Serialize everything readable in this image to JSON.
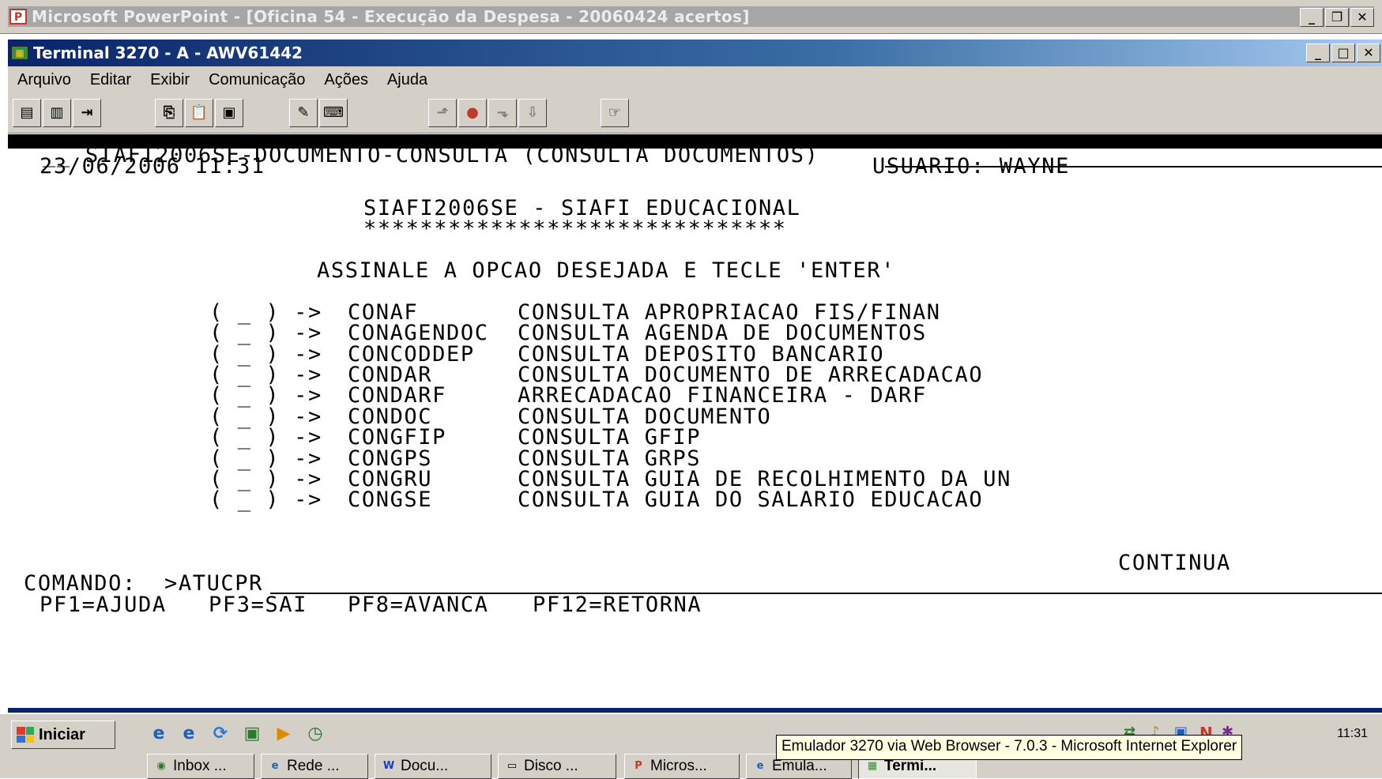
{
  "powerpoint": {
    "title": "Microsoft PowerPoint - [Oficina 54 - Execução da Despesa - 20060424 acertos]"
  },
  "terminal_window": {
    "title": "Terminal 3270 - A - AWV61442"
  },
  "menu": [
    "Arquivo",
    "Editar",
    "Exibir",
    "Comunicação",
    "Ações",
    "Ajuda"
  ],
  "screen": {
    "header_line": "SIAFI2006SE-DOCUMENTO-CONSULTA (CONSULTA DOCUMENTOS)",
    "header_prefix": "__",
    "datetime": "23/06/2006 11:31",
    "user": "USUARIO: WAYNE",
    "system_title": "SIAFI2006SE - SIAFI EDUCACIONAL",
    "stars": "******************************",
    "instruction": "ASSINALE A OPCAO DESEJADA E TECLE 'ENTER'",
    "options": [
      {
        "check": "( _ ) ->",
        "code": "CONAF",
        "desc": "CONSULTA APROPRIACAO FIS/FINAN"
      },
      {
        "check": "( _ ) ->",
        "code": "CONAGENDOC",
        "desc": "CONSULTA AGENDA DE DOCUMENTOS"
      },
      {
        "check": "( _ ) ->",
        "code": "CONCODDEP",
        "desc": "CONSULTA DEPOSITO BANCARIO"
      },
      {
        "check": "( _ ) ->",
        "code": "CONDAR",
        "desc": "CONSULTA DOCUMENTO DE ARRECADACAO"
      },
      {
        "check": "( _ ) ->",
        "code": "CONDARF",
        "desc": "ARRECADACAO FINANCEIRA - DARF"
      },
      {
        "check": "( _ ) ->",
        "code": "CONDOC",
        "desc": "CONSULTA DOCUMENTO"
      },
      {
        "check": "( _ ) ->",
        "code": "CONGFIP",
        "desc": "CONSULTA GFIP"
      },
      {
        "check": "( _ ) ->",
        "code": "CONGPS",
        "desc": "CONSULTA GRPS"
      },
      {
        "check": "( _ ) ->",
        "code": "CONGRU",
        "desc": "CONSULTA GUIA DE RECOLHIMENTO DA UN"
      },
      {
        "check": "( _ ) ->",
        "code": "CONGSE",
        "desc": "CONSULTA GUIA DO SALARIO EDUCACAO"
      }
    ],
    "continua": "CONTINUA",
    "command_label": "COMANDO:",
    "command_value": ">ATUCPR",
    "pf_keys": [
      "PF1=AJUDA",
      "PF3=SAI",
      "PF8=AVANCA",
      "PF12=RETORNA"
    ]
  },
  "taskbar": {
    "start_label": "Iniciar",
    "tooltip": "Emulador 3270 via Web Browser - 7.0.3 - Microsoft Internet Explorer",
    "clock": "11:31",
    "tasks": [
      "Inbox ...",
      "Rede ...",
      "Docu...",
      "Disco ...",
      "Micros...",
      "Emula...",
      "Termi..."
    ]
  }
}
